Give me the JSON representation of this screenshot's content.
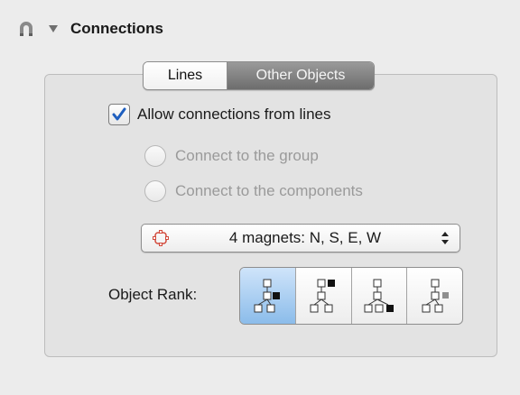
{
  "header": {
    "title": "Connections",
    "icon": "magnet-icon",
    "disclosure_icon": "disclosure-triangle-down-icon"
  },
  "tabs": {
    "items": [
      {
        "label": "Lines",
        "selected": false
      },
      {
        "label": "Other Objects",
        "selected": true
      }
    ]
  },
  "options": {
    "allow_connections_label": "Allow connections from lines",
    "allow_connections_checked": true,
    "connect_group_label": "Connect to the group",
    "connect_components_label": "Connect to the components",
    "radio_enabled": false
  },
  "magnets": {
    "selected_label": "4 magnets: N, S, E, W",
    "icon": "magnet-outline-icon"
  },
  "object_rank": {
    "label": "Object Rank:",
    "options": [
      "rank-center-icon",
      "rank-top-right-icon",
      "rank-bottom-right-icon",
      "rank-middle-right-icon"
    ],
    "selected_index": 0
  },
  "colors": {
    "background": "#ececec",
    "selected_segment": "#8bbcea",
    "tab_selected": "#7d7d7d",
    "check_blue": "#1f5fbf",
    "magnet_red": "#d24a3c"
  }
}
